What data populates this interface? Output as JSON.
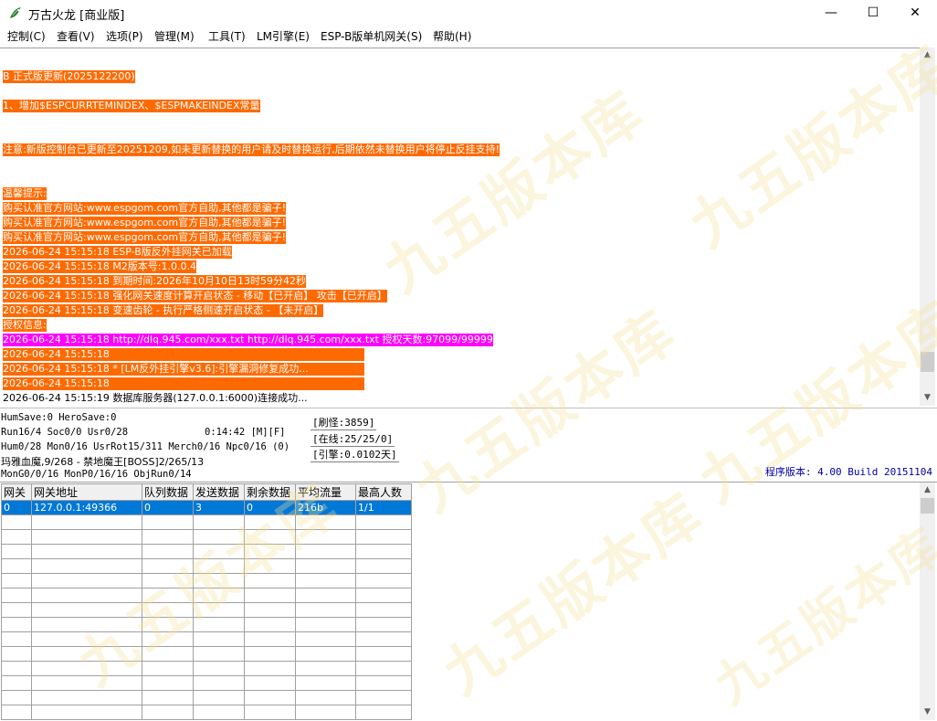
{
  "window": {
    "title": "万古火龙 [商业版]",
    "controls": {
      "minimize": "—",
      "maximize": "☐",
      "close": "✕"
    }
  },
  "menu": [
    "控制(C)",
    "查看(V)",
    "选项(P)",
    "管理(M)",
    "工具(T)",
    "LM引擎(E)",
    "ESP-B版单机网关(S)",
    "帮助(H)"
  ],
  "log": [
    "B 正式版更新(2025122200)",
    "1、增加$ESPCURRTEMINDEX、$ESPMAKEINDEX常量",
    "注意:新版控制台已更新至20251209,如未更新替换的用户请及时替换运行,后期依然未替换用户将停止反挂支持!",
    "温馨提示:",
    "购买认准官方网站:www.espgom.com官方自助,其他都是骗子!",
    "购买认准官方网站:www.espgom.com官方自助,其他都是骗子!",
    "购买认准官方网站:www.espgom.com官方自助,其他都是骗子!",
    "2026-06-24 15:15:18 ESP-B版反外挂网关已加载",
    "2026-06-24 15:15:18 M2版本号:1.0.0.4",
    "2026-06-24 15:15:18 到期时间:2026年10月10日13时59分42秒",
    "2026-06-24 15:15:18 强化网关速度计算开启状态 - 移动【已开启】 攻击【已开启】",
    "2026-06-24 15:15:18 变速齿轮 - 执行严格侧速开启状态 - 【未开启】",
    "授权信息:",
    "2026-06-24 15:15:18 http://dlq.945.com/xxx.txt http://dlq.945.com/xxx.txt 授权天数:97099/99999",
    "2026-06-24 15:15:18",
    "2026-06-24 15:15:18 * [LM反外挂引擎v3.6]:引擎漏洞修复成功...",
    "2026-06-24 15:15:18",
    "2026-06-24 15:15:19 数据库服务器(127.0.0.1:6000)连接成功..."
  ],
  "status": {
    "line1": "HumSave:0 HeroSave:0",
    "line2a": "Run16/4 Soc0/0 Usr0/28",
    "line2b": "0:14:42 [M][F]",
    "line3": "Hum0/28 Mon0/16 UsrRot15/311 Merch0/16 Npc0/16 (0)",
    "line4": "玛雅血魔,9/268 - 禁地魔王[BOSS]2/265/13",
    "line5": "MonG0/0/16 MonP0/16/16 ObjRun0/14",
    "refresh": "[刷怪:3859]",
    "online": "[在线:25/25/0]",
    "engine": "[引擎:0.0102天]",
    "version": "程序版本: 4.00 Build 20151104"
  },
  "table": {
    "headers": [
      "网关",
      "网关地址",
      "队列数据",
      "发送数据",
      "剩余数据",
      "平均流量",
      "最高人数"
    ],
    "rows": [
      [
        "0",
        "127.0.0.1:49366",
        "0",
        "3",
        "0",
        "216b",
        "1/1"
      ]
    ]
  },
  "watermark": {
    "text": "九五版本库",
    "url": "www.95gm.com"
  },
  "colors": {
    "log_orange": "#ff6a00",
    "log_magenta": "#ff00ff",
    "selected_row": "#0078d7",
    "version_text": "#0000a0"
  }
}
